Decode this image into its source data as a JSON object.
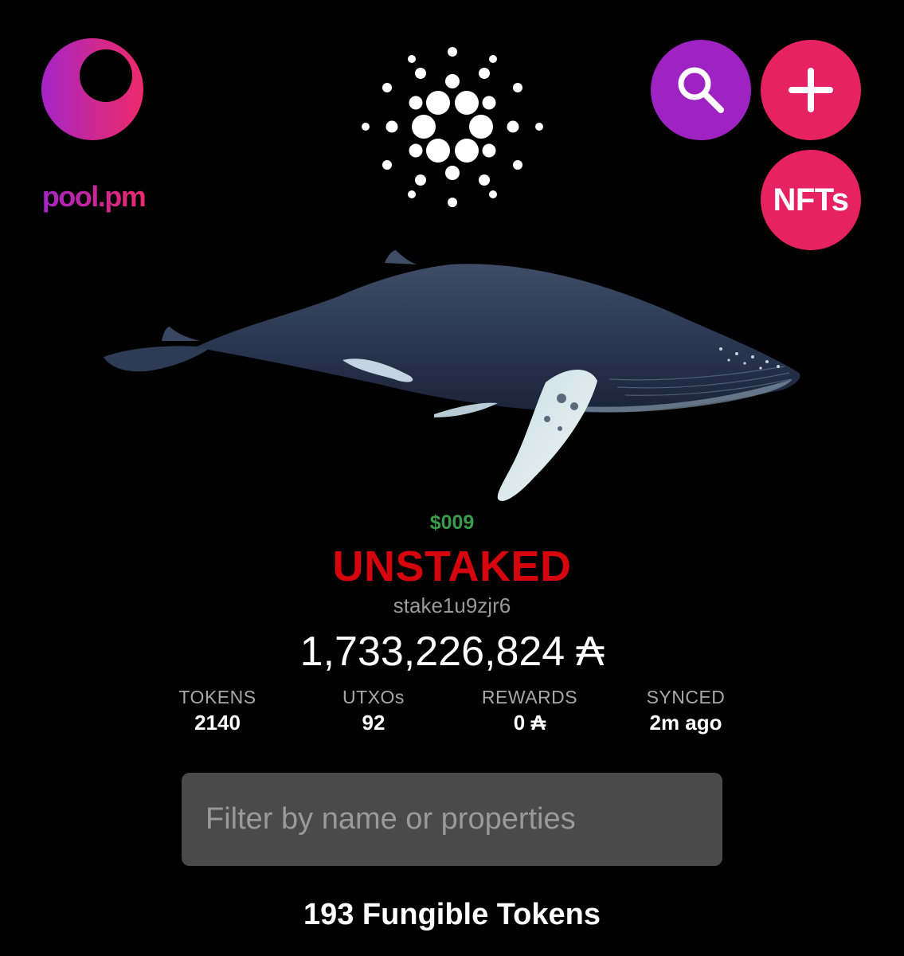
{
  "brand": {
    "logo_text": "pool.pm",
    "gradient_start": "#a424c8",
    "gradient_end": "#ee2a6c"
  },
  "header": {
    "center_icon": "cardano-icon",
    "buttons": {
      "search_icon": "search-icon",
      "add_label": "+",
      "nfts_label": "NFTs",
      "search_color": "#9f22c2",
      "accent_color": "#e72262"
    }
  },
  "wallet": {
    "illustration": "humpback-whale",
    "price": "$009",
    "status": "UNSTAKED",
    "status_color": "#d6040c",
    "stake_address": "stake1u9zjr6",
    "balance": "1,733,226,824 ₳"
  },
  "stats": [
    {
      "label": "TOKENS",
      "value": "2140"
    },
    {
      "label": "UTXOs",
      "value": "92"
    },
    {
      "label": "REWARDS",
      "value": "0 ₳"
    },
    {
      "label": "SYNCED",
      "value": "2m ago"
    }
  ],
  "filter": {
    "placeholder": "Filter by name or properties",
    "value": ""
  },
  "section": {
    "title": "193 Fungible Tokens"
  }
}
